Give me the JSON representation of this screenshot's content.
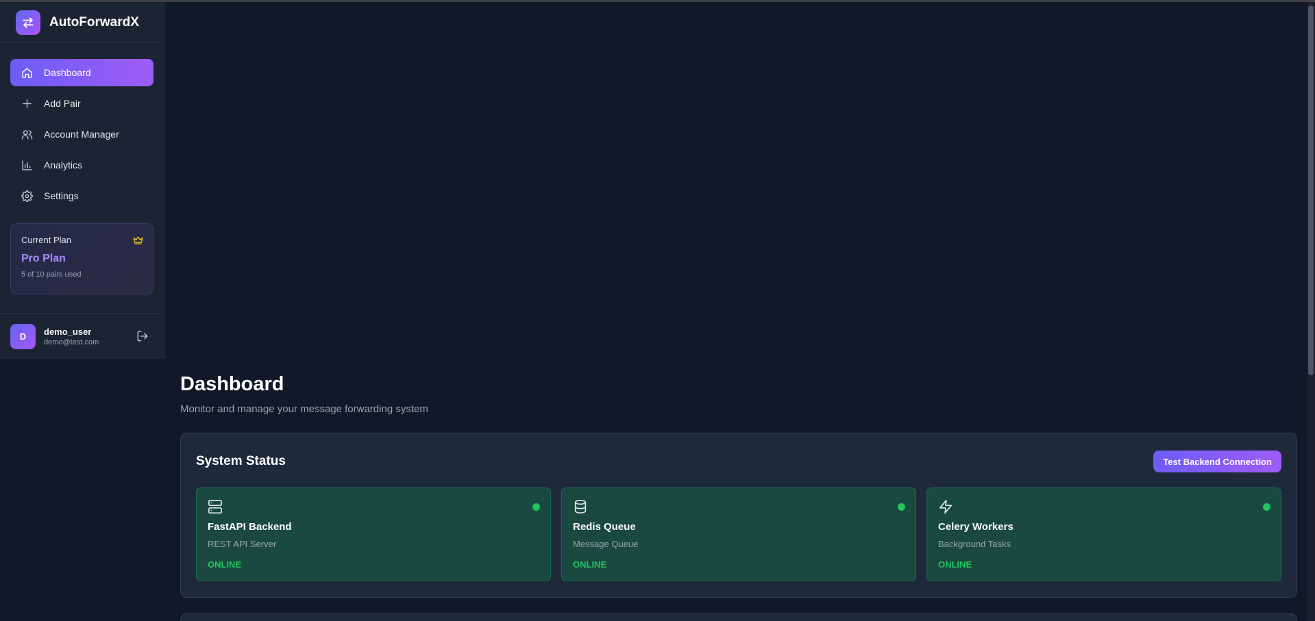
{
  "app": {
    "name": "AutoForwardX"
  },
  "sidebar": {
    "items": [
      {
        "label": "Dashboard",
        "icon": "home-icon",
        "active": true
      },
      {
        "label": "Add Pair",
        "icon": "plus-icon",
        "active": false
      },
      {
        "label": "Account Manager",
        "icon": "users-icon",
        "active": false
      },
      {
        "label": "Analytics",
        "icon": "bar-chart-icon",
        "active": false
      },
      {
        "label": "Settings",
        "icon": "gear-icon",
        "active": false
      }
    ],
    "plan": {
      "label": "Current Plan",
      "name": "Pro Plan",
      "usage": "5 of 10 pairs used",
      "crown_color": "#facc15"
    },
    "user": {
      "initial": "D",
      "name": "demo_user",
      "email": "demo@test.com"
    }
  },
  "main": {
    "title": "Dashboard",
    "subtitle": "Monitor and manage your message forwarding system",
    "status": {
      "title": "System Status",
      "test_button": "Test Backend Connection",
      "services": [
        {
          "name": "FastAPI Backend",
          "desc": "REST API Server",
          "status": "ONLINE",
          "icon": "server-icon"
        },
        {
          "name": "Redis Queue",
          "desc": "Message Queue",
          "status": "ONLINE",
          "icon": "database-icon"
        },
        {
          "name": "Celery Workers",
          "desc": "Background Tasks",
          "status": "ONLINE",
          "icon": "lightning-icon"
        }
      ]
    }
  },
  "colors": {
    "accent_start": "#6d5df5",
    "accent_end": "#9f5cf7",
    "online": "#22c55e",
    "background": "#111827"
  }
}
